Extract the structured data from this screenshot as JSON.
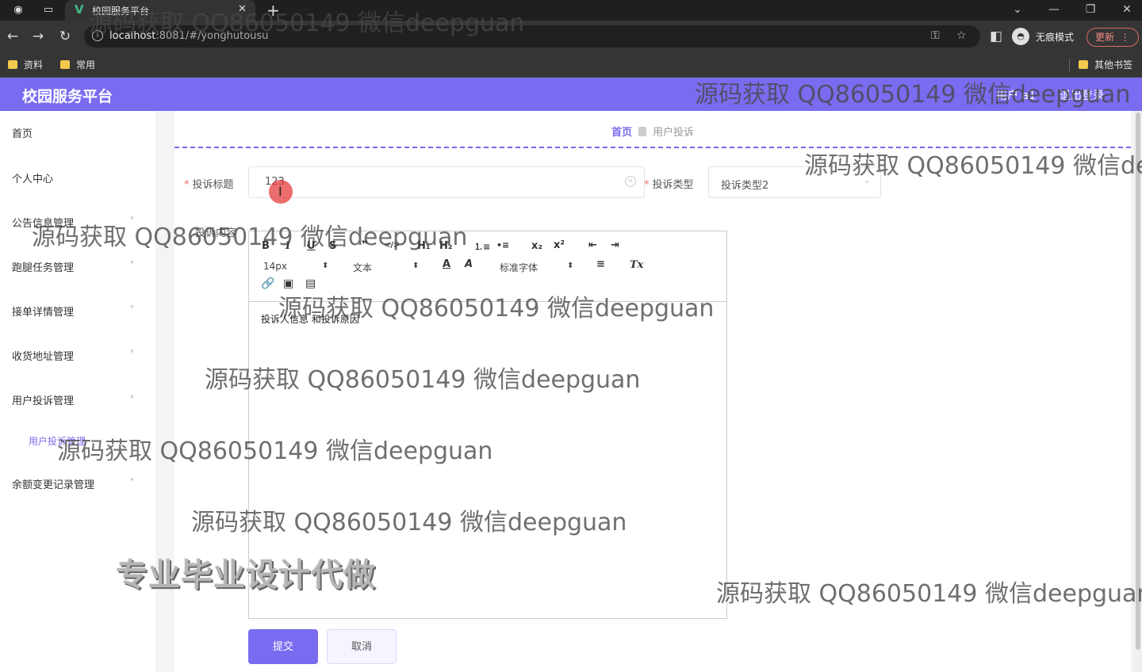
{
  "browser": {
    "tab_title": "校园服务平台",
    "tab_favicon": "V",
    "url_host": "localhost",
    "url_rest": ":8081/#/yonghutousu",
    "incognito_label": "无痕模式",
    "update_label": "更新",
    "bookmarks": [
      "资料",
      "常用"
    ],
    "other_bookmarks": "其他书签"
  },
  "app": {
    "title": "校园服务平台",
    "user_label": "用户 a1",
    "logout_label": "退出登录"
  },
  "sidebar": {
    "items": [
      {
        "label": "首页"
      },
      {
        "label": "个人中心"
      },
      {
        "label": "公告信息管理"
      },
      {
        "label": "跑腿任务管理"
      },
      {
        "label": "接单详情管理"
      },
      {
        "label": "收货地址管理"
      },
      {
        "label": "用户投诉管理"
      },
      {
        "label": "用户投诉管理"
      },
      {
        "label": "余额变更记录管理"
      }
    ]
  },
  "breadcrumb": {
    "home": "首页",
    "current": "用户投诉"
  },
  "form": {
    "title_label": "投诉标题",
    "title_value": "123",
    "type_label": "投诉类型",
    "type_value": "投诉类型2",
    "content_label": "投诉内容",
    "content_value": "投诉人信息 和投诉原因",
    "submit_label": "提交",
    "cancel_label": "取消"
  },
  "editor_toolbar": {
    "bold": "B",
    "italic": "I",
    "underline": "U",
    "strike": "S",
    "quote": "❞",
    "code": "</>",
    "h1": "H₁",
    "h2": "H₂",
    "ordered_list": "⒈≡",
    "bullet_list": "•≡",
    "subscript": "x₂",
    "superscript": "x²",
    "outdent": "⇤",
    "indent": "⇥",
    "size": "14px",
    "header": "文本",
    "color": "A",
    "background": "A",
    "font": "标准字体",
    "align": "≡",
    "clean": "Tx"
  },
  "overlays": {
    "watermark": "源码获取 QQ86050149 微信deepguan",
    "promo": "专业毕业设计代做"
  },
  "colors": {
    "accent": "#7a6cf0",
    "required": "#f56c6c"
  }
}
